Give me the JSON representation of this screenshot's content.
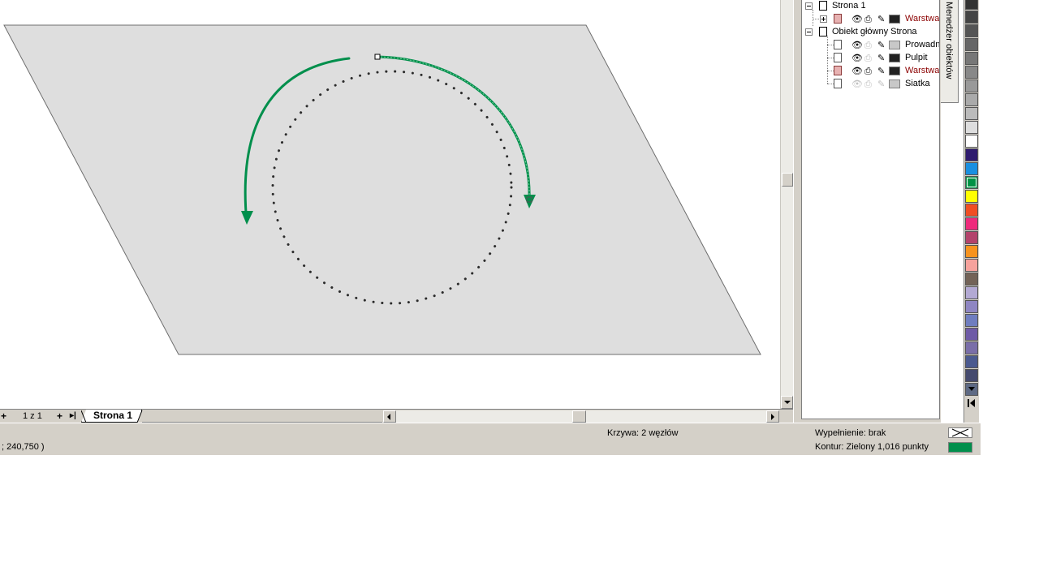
{
  "colors": {
    "page_fill": "#dedede",
    "page_border": "#6e6e6e",
    "arrow_green": "#008f4c",
    "dotted_circle": "#2b2b2b",
    "ui_face": "#d4d0c8"
  },
  "object_manager": {
    "tab_title": "Menedżer obiektów",
    "rows": [
      {
        "label": "Strona 1",
        "kind": "page",
        "expander": "minus"
      },
      {
        "label": "Warstwa",
        "kind": "layer",
        "expander": "plus",
        "color": "#222222",
        "highlight": true
      },
      {
        "label": "Obiekt główny Strona",
        "kind": "page",
        "expander": "minus"
      },
      {
        "label": "Prowadn",
        "kind": "layer",
        "color": "#c8c8c8"
      },
      {
        "label": "Pulpit",
        "kind": "layer",
        "color": "#222222"
      },
      {
        "label": "Warstwa",
        "kind": "layer",
        "color": "#222222",
        "highlight": true
      },
      {
        "label": "Siatka",
        "kind": "layer",
        "color": "#c8c8c8"
      }
    ]
  },
  "palette": {
    "colors": [
      "#333333",
      "#444444",
      "#555555",
      "#666666",
      "#777777",
      "#888888",
      "#999999",
      "#aaaaaa",
      "#bbbbbb",
      "#dddddd",
      "#ffffff",
      "#2e1a6e",
      "#1a8fe0",
      "#009245",
      "#ffff00",
      "#f04e23",
      "#ee2a7b",
      "#b3436b",
      "#f7931e",
      "#f6a29c",
      "#736357",
      "#b3a9d3",
      "#8f86c2",
      "#6f7dbf",
      "#6e5aa6",
      "#7a6ea8",
      "#4b5a8f",
      "#454a6e",
      "#5e6a84"
    ],
    "selected_index": 13
  },
  "pages": {
    "count_label": "1 z 1",
    "active_tab": "Strona 1",
    "add_glyph": "+",
    "last_glyph": "▸|"
  },
  "status": {
    "coordinates": "; 240,750 )",
    "object_info": "Krzywa: 2 węzłów",
    "fill": "Wypełnienie: brak",
    "outline": "Kontur:  Zielony 1,016 punkty",
    "outline_color": "#008f4c"
  }
}
